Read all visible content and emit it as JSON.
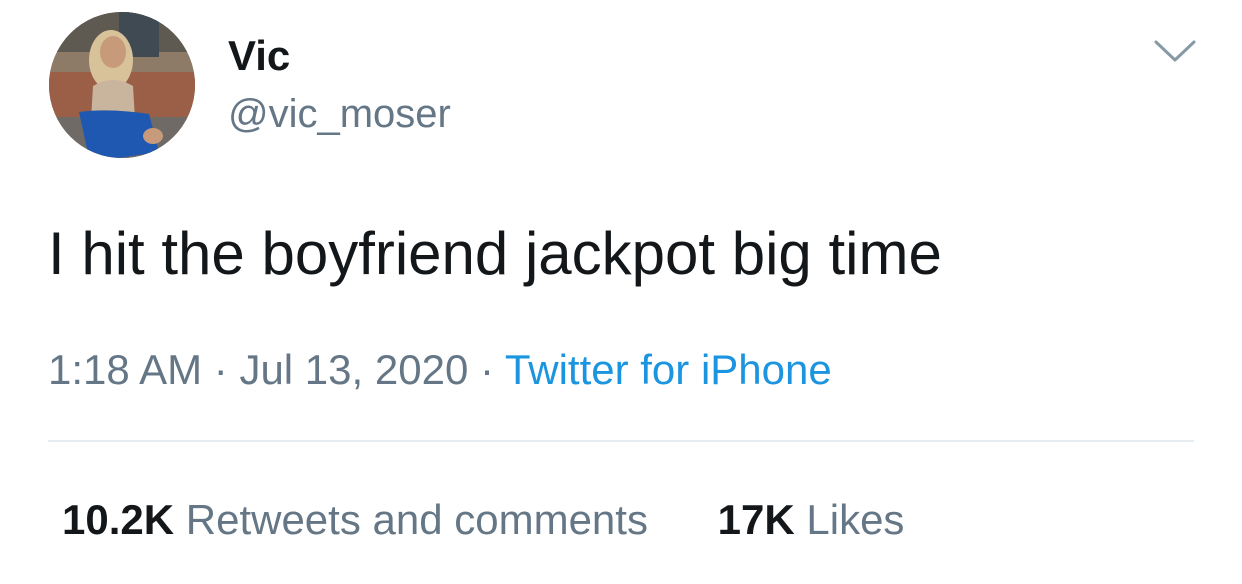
{
  "tweet": {
    "author": {
      "display_name": "Vic",
      "handle": "@vic_moser"
    },
    "text": "I hit the boyfriend jackpot big time",
    "time": "1:18 AM",
    "separator": "·",
    "date": "Jul 13, 2020",
    "source": "Twitter for iPhone"
  },
  "stats": {
    "retweets_count": "10.2K",
    "retweets_label": "Retweets and comments",
    "likes_count": "17K",
    "likes_label": "Likes"
  },
  "icons": {
    "menu": "chevron-down-icon"
  },
  "colors": {
    "text": "#14171a",
    "secondary": "#657786",
    "link": "#1b95e0",
    "divider": "#e6ecf0"
  }
}
